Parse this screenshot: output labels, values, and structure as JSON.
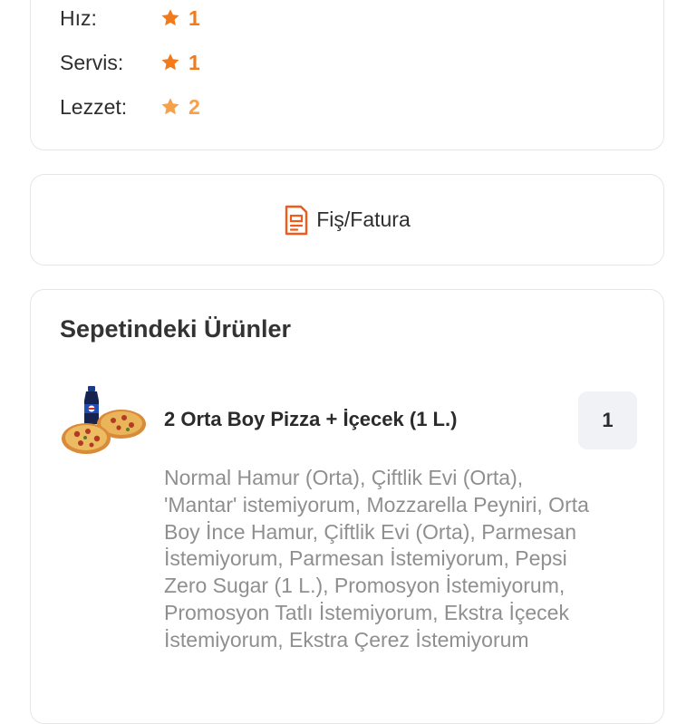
{
  "ratings": [
    {
      "label": "Hız:",
      "value": "1",
      "color": "#f27a1a"
    },
    {
      "label": "Servis:",
      "value": "1",
      "color": "#f27a1a"
    },
    {
      "label": "Lezzet:",
      "value": "2",
      "color": "#f5a04a"
    }
  ],
  "receipt": {
    "label": "Fiş/Fatura",
    "icon": "receipt-icon",
    "icon_color": "#f05a1a"
  },
  "basket": {
    "title": "Sepetindeki Ürünler",
    "items": [
      {
        "name": "2 Orta Boy Pizza + İçecek (1 L.)",
        "quantity": "1",
        "image": "pizza-and-cola-image",
        "description": "Normal Hamur (Orta), Çiftlik Evi (Orta), 'Mantar' istemiyorum, Mozzarella Peyniri, Orta Boy İnce Hamur, Çiftlik Evi (Orta), Parmesan İstemiyorum, Parmesan İstemiyorum, Pepsi Zero Sugar (1 L.), Promosyon İstemiyorum, Promosyon Tatlı İstemiyorum, Ekstra İçecek İstemiyorum, Ekstra Çerez İstemiyorum"
      }
    ]
  }
}
